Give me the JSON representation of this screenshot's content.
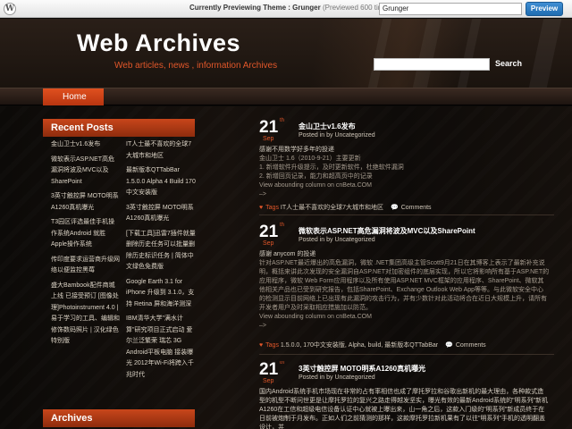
{
  "preview_bar": {
    "prefix": "Currently Previewing Theme : ",
    "theme": "Grunger",
    "count": "(Previewed 600 times)",
    "selected_theme": "Grunger",
    "button": "Preview"
  },
  "header": {
    "title": "Web Archives",
    "tagline": "Web articles, news , information Archives",
    "search_value": "",
    "search_label": "Search"
  },
  "nav": {
    "home": "Home"
  },
  "sidebar": {
    "recent_title": "Recent Posts",
    "archives_title": "Archives",
    "recent_col1": [
      "金山卫士v1.6发布",
      "微软表示ASP.NET高危漏洞将波及MVC以及SharePoint",
      "3英寸触控屏 MOTO明系A1260真机曝光",
      "T3园区评选最佳手机操作系统Android 就胜Apple操作系统",
      "传印度要求运营商升级网络以便监控黑莓",
      "盛大Bambook配件商城上线 已接受预订 [图像处理]Photoinstrument 4.0 | 易于学习的工具、编辑和修饰数码照片 | 汉化绿色特别版"
    ],
    "recent_col2": [
      "IT人士最不喜欢的全球7大城市和地区",
      "最新版本QTTabBar 1.5.0.0 Alpha 4 Build 170中文安装版",
      "3英寸触控屏 MOTO明系A1260真机曝光",
      "[下载工具]迅雷7插件就量删除历史任务可以批量删除历史标识任务 | 简体中文绿色免费版",
      "Google Earth 3.1 for iPhone 升级到 3.1.0，支持 Retina 屏和海洋测深",
      "IBM清华大学\"满水计算\"研究项目正式启动 爱尔兰泛繁荣 瑞芯 3G Android平板电脑 接装曝光 2012年Wi-Fi将跨入千兆时代"
    ]
  },
  "posts": [
    {
      "day": "21",
      "suffix": "th",
      "month": "Sep",
      "title": "金山卫士v1.6发布",
      "meta_prefix": "Posted in by ",
      "author": "Uncategorized",
      "body_lines": [
        "感谢不用数学好多年的投递",
        "金山卫士 1.6（2010-9-21）主要更新",
        "1. 新增软件升级提示，及时更新软件，杜绝软件漏洞",
        "2. 新增回页记录，能力和超高页中的记录",
        "View abounding column on cnBeta.COM",
        "–>"
      ],
      "tags_label": "Tags",
      "tags": "IT人士最不喜欢的全球7大城市和地区",
      "comments": "Comments"
    },
    {
      "day": "21",
      "suffix": "th",
      "month": "Sep",
      "title": "微软表示ASP.NET高危漏洞将波及MVC以及SharePoint",
      "meta_prefix": "Posted in by ",
      "author": "Uncategorized",
      "body_lines": [
        "感谢 anycom 的投递",
        "针对ASP.NET最近爆出的高危漏洞，微软 .NET集团高级主管Scott9月21日在其博客上表示了最新补充说明，概括来讲此次发现的安全漏洞自ASP.NET对加密组件的底层实现，所以它将影响所有基于ASP.NET的应用程序，微软 Web Form应用程序以及所有使用ASP.NET MVC框架的应用程序、SharePoint、微软其他相关产品也已受到研究报告，包括SharePoint、Exchange Outlook Web App等等。与此微软安全中心的检测显示目前网络上已出现有此漏洞的攻击行为，并有少数针对此活动将合在近日大规模上升，请所有开发者用户及时采取相应措施加以防范。",
        "View abounding column on cnBeta.COM",
        "–>"
      ],
      "tags_label": "Tags",
      "tags": "1.5.0.0, 170中文安装版, Alpha, build, 最新版本QTTabBar",
      "comments": "Comments"
    },
    {
      "day": "21",
      "suffix": "th",
      "month": "Sep",
      "title": "3英寸触控屏 MOTO明系A1260真机曝光",
      "meta_prefix": "Posted in by ",
      "author": "Uncategorized",
      "body_lines": [
        "国内Android系统手机市场现在非常的占有率相信也成了摩托罗拉和谷歌出新机的最大理由，各种款式造型的机型不断问世更是让摩托罗拉的复兴之路走得越发坚实，曝光有效的最新Android系统的\"明系列\"新机A1260在工信和超级电信设备认证中心就被上曝出来，山一角之后，这款入门级的\"明系列\"新成员终于在日前被炮制于月发布。正如人们之前猜测的那样，这款摩托罗拉新机果有了以往\"明系列\"手机的透明翻盖设计，并"
      ]
    }
  ]
}
